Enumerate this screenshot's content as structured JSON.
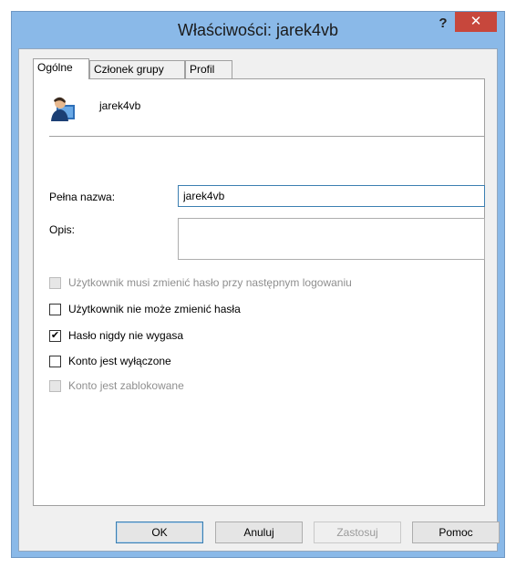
{
  "window": {
    "title": "Właściwości: jarek4vb",
    "help_label": "?",
    "close_label": "✕"
  },
  "tabs": [
    {
      "label": "Ogólne"
    },
    {
      "label": "Członek grupy"
    },
    {
      "label": "Profil"
    }
  ],
  "user": {
    "name": "jarek4vb",
    "icon": "user-icon"
  },
  "form": {
    "full_name_label": "Pełna nazwa:",
    "full_name_value": "jarek4vb",
    "description_label": "Opis:",
    "description_value": ""
  },
  "checkboxes": [
    {
      "label": "Użytkownik musi zmienić hasło przy następnym logowaniu",
      "checked": false,
      "disabled": true
    },
    {
      "label": "Użytkownik nie może zmienić hasła",
      "checked": false,
      "disabled": false
    },
    {
      "label": "Hasło nigdy nie wygasa",
      "checked": true,
      "disabled": false
    },
    {
      "label": "Konto jest wyłączone",
      "checked": false,
      "disabled": false
    },
    {
      "label": "Konto jest zablokowane",
      "checked": false,
      "disabled": true
    }
  ],
  "buttons": {
    "ok": "OK",
    "cancel": "Anuluj",
    "apply": "Zastosuj",
    "help": "Pomoc"
  },
  "check_glyph": "✔"
}
